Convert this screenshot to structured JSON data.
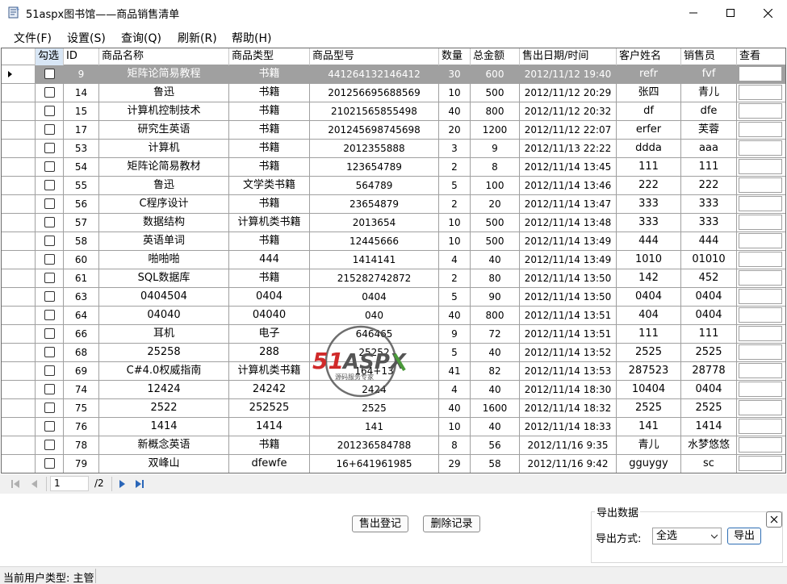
{
  "window": {
    "title": "51aspx图书馆——商品销售清单"
  },
  "menu": [
    "文件(F)",
    "设置(S)",
    "查询(Q)",
    "刷新(R)",
    "帮助(H)"
  ],
  "grid": {
    "columns": [
      "勾选",
      "ID",
      "商品名称",
      "商品类型",
      "商品型号",
      "数量",
      "总金额",
      "售出日期/时间",
      "客户姓名",
      "销售员",
      "查看"
    ],
    "rows": [
      {
        "id": "9",
        "name": "矩阵论简易教程",
        "type": "书籍",
        "model": "441264132146412",
        "qty": "30",
        "amount": "600",
        "date": "2012/11/12 19:40",
        "customer": "refr",
        "seller": "fvf"
      },
      {
        "id": "14",
        "name": "鲁迅",
        "type": "书籍",
        "model": "201256695688569",
        "qty": "10",
        "amount": "500",
        "date": "2012/11/12 20:29",
        "customer": "张四",
        "seller": "青儿"
      },
      {
        "id": "15",
        "name": "计算机控制技术",
        "type": "书籍",
        "model": "21021565855498",
        "qty": "40",
        "amount": "800",
        "date": "2012/11/12 20:32",
        "customer": "df",
        "seller": "dfe"
      },
      {
        "id": "17",
        "name": "研究生英语",
        "type": "书籍",
        "model": "201245698745698",
        "qty": "20",
        "amount": "1200",
        "date": "2012/11/12 22:07",
        "customer": "erfer",
        "seller": "芙蓉"
      },
      {
        "id": "53",
        "name": "计算机",
        "type": "书籍",
        "model": "2012355888",
        "qty": "3",
        "amount": "9",
        "date": "2012/11/13 22:22",
        "customer": "ddda",
        "seller": "aaa"
      },
      {
        "id": "54",
        "name": "矩阵论简易教材",
        "type": "书籍",
        "model": "123654789",
        "qty": "2",
        "amount": "8",
        "date": "2012/11/14 13:45",
        "customer": "111",
        "seller": "111"
      },
      {
        "id": "55",
        "name": "鲁迅",
        "type": "文学类书籍",
        "model": "564789",
        "qty": "5",
        "amount": "100",
        "date": "2012/11/14 13:46",
        "customer": "222",
        "seller": "222"
      },
      {
        "id": "56",
        "name": "C程序设计",
        "type": "书籍",
        "model": "23654879",
        "qty": "2",
        "amount": "20",
        "date": "2012/11/14 13:47",
        "customer": "333",
        "seller": "333"
      },
      {
        "id": "57",
        "name": "数据结构",
        "type": "计算机类书籍",
        "model": "2013654",
        "qty": "10",
        "amount": "500",
        "date": "2012/11/14 13:48",
        "customer": "333",
        "seller": "333"
      },
      {
        "id": "58",
        "name": "英语单词",
        "type": "书籍",
        "model": "12445666",
        "qty": "10",
        "amount": "500",
        "date": "2012/11/14 13:49",
        "customer": "444",
        "seller": "444"
      },
      {
        "id": "60",
        "name": "啪啪啪",
        "type": "444",
        "model": "1414141",
        "qty": "4",
        "amount": "40",
        "date": "2012/11/14 13:49",
        "customer": "1010",
        "seller": "01010"
      },
      {
        "id": "61",
        "name": "SQL数据库",
        "type": "书籍",
        "model": "215282742872",
        "qty": "2",
        "amount": "80",
        "date": "2012/11/14 13:50",
        "customer": "142",
        "seller": "452"
      },
      {
        "id": "63",
        "name": "0404504",
        "type": "0404",
        "model": "0404",
        "qty": "5",
        "amount": "90",
        "date": "2012/11/14 13:50",
        "customer": "0404",
        "seller": "0404"
      },
      {
        "id": "64",
        "name": "04040",
        "type": "04040",
        "model": "040",
        "qty": "40",
        "amount": "800",
        "date": "2012/11/14 13:51",
        "customer": "404",
        "seller": "0404"
      },
      {
        "id": "66",
        "name": "耳机",
        "type": "电子",
        "model": "646465",
        "qty": "9",
        "amount": "72",
        "date": "2012/11/14 13:51",
        "customer": "111",
        "seller": "111"
      },
      {
        "id": "68",
        "name": "25258",
        "type": "288",
        "model": "25252",
        "qty": "5",
        "amount": "40",
        "date": "2012/11/14 13:52",
        "customer": "2525",
        "seller": "2525"
      },
      {
        "id": "69",
        "name": "C#4.0权威指南",
        "type": "计算机类书籍",
        "model": "164+13",
        "qty": "41",
        "amount": "82",
        "date": "2012/11/14 13:53",
        "customer": "287523",
        "seller": "28778"
      },
      {
        "id": "74",
        "name": "12424",
        "type": "24242",
        "model": "2424",
        "qty": "4",
        "amount": "40",
        "date": "2012/11/14 18:30",
        "customer": "10404",
        "seller": "0404"
      },
      {
        "id": "75",
        "name": "2522",
        "type": "252525",
        "model": "2525",
        "qty": "40",
        "amount": "1600",
        "date": "2012/11/14 18:32",
        "customer": "2525",
        "seller": "2525"
      },
      {
        "id": "76",
        "name": "1414",
        "type": "1414",
        "model": "141",
        "qty": "10",
        "amount": "40",
        "date": "2012/11/14 18:33",
        "customer": "141",
        "seller": "1414"
      },
      {
        "id": "78",
        "name": "新概念英语",
        "type": "书籍",
        "model": "201236584788",
        "qty": "8",
        "amount": "56",
        "date": "2012/11/16 9:35",
        "customer": "青儿",
        "seller": "水梦悠悠"
      },
      {
        "id": "79",
        "name": "双峰山",
        "type": "dfewfe",
        "model": "16+641961985",
        "qty": "29",
        "amount": "58",
        "date": "2012/11/16 9:42",
        "customer": "gguygy",
        "seller": "sc"
      }
    ]
  },
  "pager": {
    "current": "1",
    "total": "/2"
  },
  "actions": {
    "sell_label": "售出登记",
    "delete_label": "删除记录"
  },
  "export": {
    "title": "导出数据",
    "method_label": "导出方式:",
    "method_value": "全选",
    "button_label": "导出"
  },
  "watermark": {
    "brand": "51ASPX",
    "tagline": "源码服务专家"
  },
  "status": {
    "text": "当前用户类型: 主管"
  }
}
